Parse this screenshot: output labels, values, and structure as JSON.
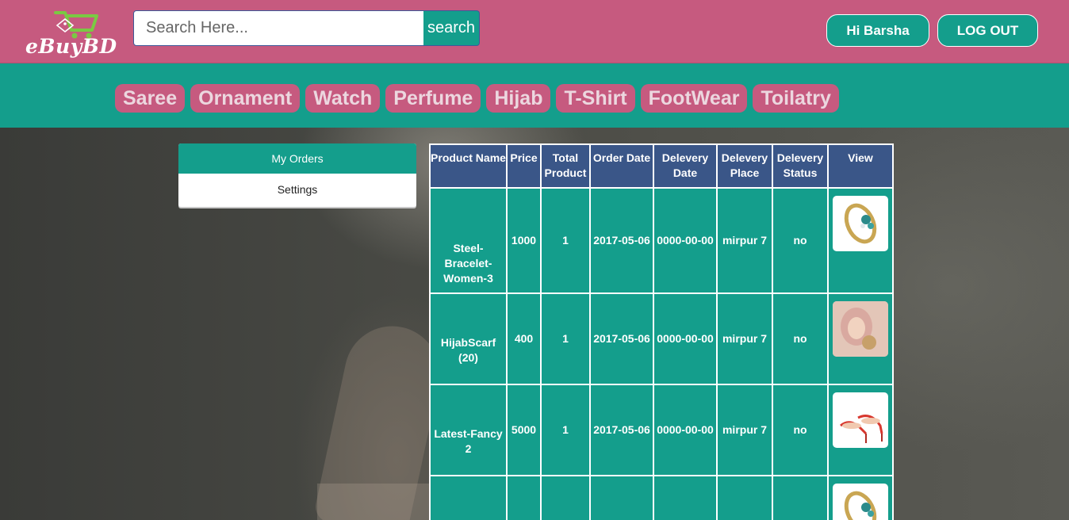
{
  "brand": {
    "name": "eBuyBD"
  },
  "search": {
    "placeholder": "Search Here...",
    "button_label": "search"
  },
  "user": {
    "greeting": "Hi Barsha",
    "logout_label": "LOG OUT"
  },
  "categories": [
    "Saree",
    "Ornament",
    "Watch",
    "Perfume",
    "Hijab",
    "T-Shirt",
    "FootWear",
    "Toilatry"
  ],
  "sidebar": {
    "items": [
      {
        "label": "My Orders",
        "active": true
      },
      {
        "label": "Settings",
        "active": false
      }
    ]
  },
  "orders": {
    "headers": [
      "Product Name",
      "Price",
      "Total Product",
      "Order Date",
      "Delevery Date",
      "Delevery Place",
      "Delevery Status",
      "View"
    ],
    "rows": [
      {
        "name": "Steel-Bracelet-Women-3",
        "price": "1000",
        "total": "1",
        "order_date": "2017-05-06",
        "delivery_date": "0000-00-00",
        "place": "mirpur 7",
        "status": "no",
        "thumb_icon": "bracelet-icon"
      },
      {
        "name": "HijabScarf (20)",
        "price": "400",
        "total": "1",
        "order_date": "2017-05-06",
        "delivery_date": "0000-00-00",
        "place": "mirpur 7",
        "status": "no",
        "thumb_icon": "hijab-icon"
      },
      {
        "name": "Latest-Fancy 2",
        "price": "5000",
        "total": "1",
        "order_date": "2017-05-06",
        "delivery_date": "0000-00-00",
        "place": "mirpur 7",
        "status": "no",
        "thumb_icon": "sandal-icon"
      },
      {
        "name": "",
        "price": "",
        "total": "",
        "order_date": "",
        "delivery_date": "",
        "place": "",
        "status": "",
        "thumb_icon": "bracelet-icon"
      }
    ]
  },
  "colors": {
    "header": "#c65a7f",
    "teal": "#149e8c",
    "table_header": "#3a5688"
  }
}
